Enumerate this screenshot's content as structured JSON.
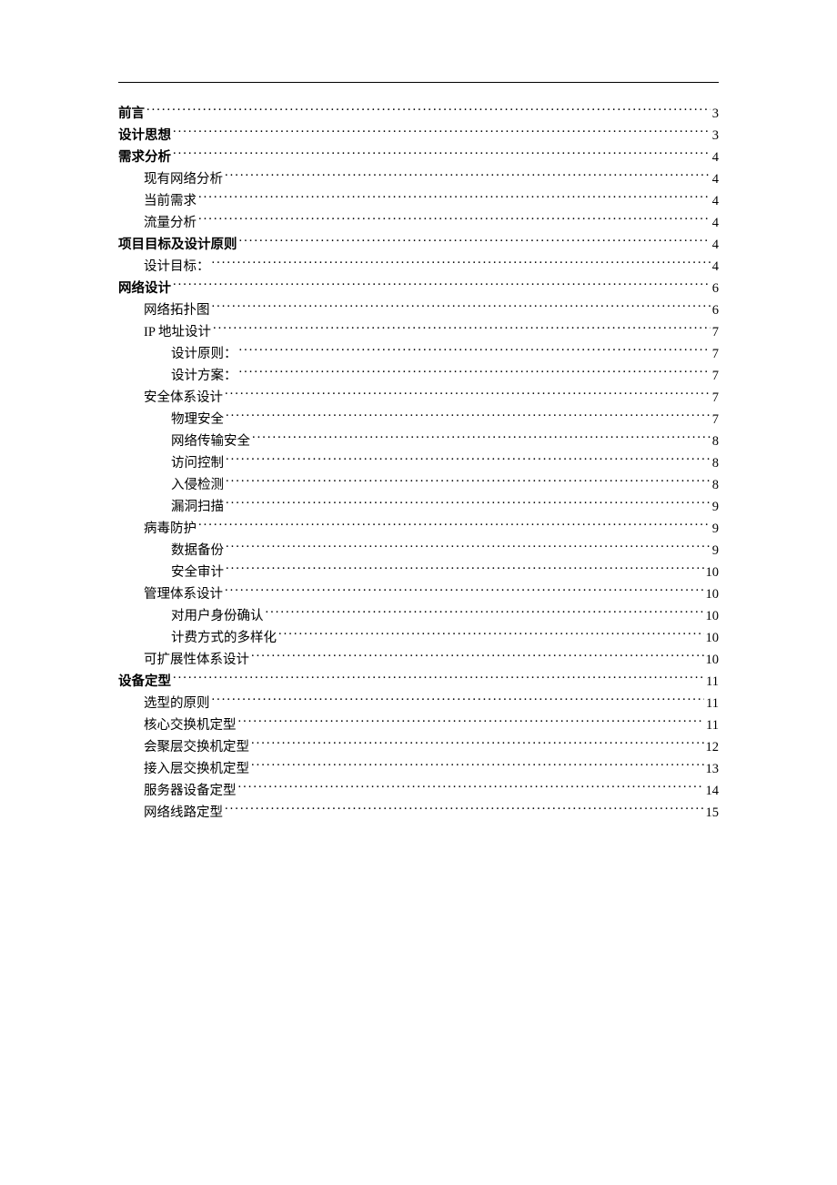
{
  "toc": [
    {
      "label": "前言",
      "page": "3",
      "level": 0,
      "bold": true
    },
    {
      "label": "设计思想",
      "page": "3",
      "level": 0,
      "bold": true
    },
    {
      "label": "需求分析",
      "page": "4",
      "level": 0,
      "bold": true
    },
    {
      "label": "现有网络分析",
      "page": "4",
      "level": 1,
      "bold": false
    },
    {
      "label": "当前需求",
      "page": "4",
      "level": 1,
      "bold": false
    },
    {
      "label": "流量分析",
      "page": "4",
      "level": 1,
      "bold": false
    },
    {
      "label": "项目目标及设计原则",
      "page": "4",
      "level": 0,
      "bold": true
    },
    {
      "label": "设计目标：",
      "page": "4",
      "level": 1,
      "bold": false
    },
    {
      "label": "网络设计",
      "page": "6",
      "level": 0,
      "bold": true
    },
    {
      "label": "网络拓扑图",
      "page": "6",
      "level": 1,
      "bold": false
    },
    {
      "label": "IP 地址设计",
      "page": "7",
      "level": 1,
      "bold": false
    },
    {
      "label": "设计原则：",
      "page": "7",
      "level": 2,
      "bold": false
    },
    {
      "label": "设计方案：",
      "page": "7",
      "level": 2,
      "bold": false
    },
    {
      "label": "安全体系设计",
      "page": "7",
      "level": 1,
      "bold": false
    },
    {
      "label": "物理安全",
      "page": "7",
      "level": 2,
      "bold": false
    },
    {
      "label": "网络传输安全",
      "page": "8",
      "level": 2,
      "bold": false
    },
    {
      "label": "访问控制",
      "page": "8",
      "level": 2,
      "bold": false
    },
    {
      "label": "入侵检测",
      "page": "8",
      "level": 2,
      "bold": false
    },
    {
      "label": "漏洞扫描",
      "page": "9",
      "level": 2,
      "bold": false
    },
    {
      "label": "病毒防护",
      "page": "9",
      "level": 1,
      "bold": false
    },
    {
      "label": "数据备份",
      "page": "9",
      "level": 2,
      "bold": false
    },
    {
      "label": "安全审计",
      "page": "10",
      "level": 2,
      "bold": false
    },
    {
      "label": "管理体系设计",
      "page": "10",
      "level": 1,
      "bold": false
    },
    {
      "label": "对用户身份确认",
      "page": "10",
      "level": 2,
      "bold": false
    },
    {
      "label": "计费方式的多样化",
      "page": "10",
      "level": 2,
      "bold": false
    },
    {
      "label": "可扩展性体系设计",
      "page": "10",
      "level": 1,
      "bold": false
    },
    {
      "label": "设备定型",
      "page": "11",
      "level": 0,
      "bold": true
    },
    {
      "label": "选型的原则",
      "page": "11",
      "level": 1,
      "bold": false
    },
    {
      "label": "核心交换机定型",
      "page": "11",
      "level": 1,
      "bold": false
    },
    {
      "label": "会聚层交换机定型",
      "page": "12",
      "level": 1,
      "bold": false
    },
    {
      "label": "接入层交换机定型",
      "page": "13",
      "level": 1,
      "bold": false
    },
    {
      "label": "服务器设备定型",
      "page": "14",
      "level": 1,
      "bold": false
    },
    {
      "label": "网络线路定型",
      "page": "15",
      "level": 1,
      "bold": false
    }
  ]
}
